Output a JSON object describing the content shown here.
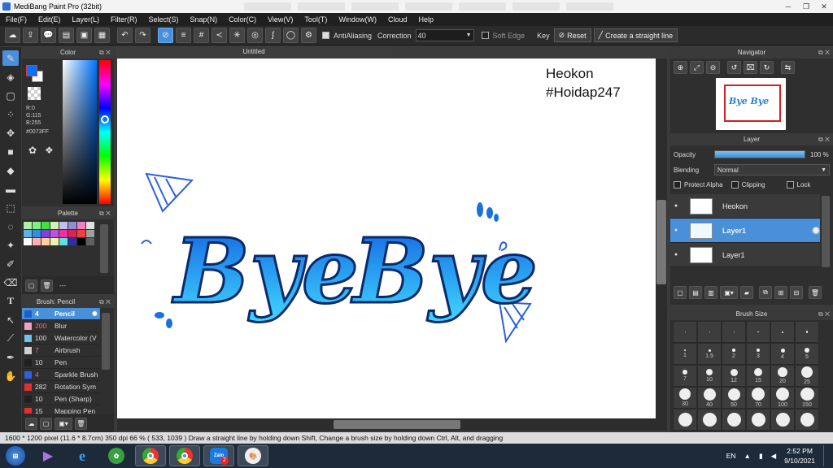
{
  "app": {
    "title": "MediBang Paint Pro (32bit)"
  },
  "menu": [
    "File(F)",
    "Edit(E)",
    "Layer(L)",
    "Filter(R)",
    "Select(S)",
    "Snap(N)",
    "Color(C)",
    "View(V)",
    "Tool(T)",
    "Window(W)",
    "Cloud",
    "Help"
  ],
  "toolbar": {
    "antialiasing_label": "AntiAliasing",
    "correction_label": "Correction",
    "correction_value": "40",
    "soft_edge_label": "Soft Edge",
    "key_label": "Key",
    "reset_label": "Reset",
    "straight_line_label": "Create a straight line"
  },
  "color_panel": {
    "title": "Color",
    "r": "R:0",
    "g": "G:115",
    "b": "B:255",
    "hex": "#0073FF",
    "primary_color": "#0073FF",
    "secondary_color": "#FFFFFF"
  },
  "palette_panel": {
    "title": "Palette",
    "colors": [
      "#b0f0a0",
      "#80f080",
      "#40e040",
      "#d0f0b0",
      "#c0c0f0",
      "#9090d0",
      "#f080c0",
      "#e0e0e0",
      "#60b0f0",
      "#3090e0",
      "#8040e0",
      "#c050e0",
      "#f030a0",
      "#e02050",
      "#f04040",
      "#a0a0a0",
      "#ffffff",
      "#ffb0b0",
      "#ffd0a0",
      "#f0f0b0",
      "#60e0e0",
      "#3030a0",
      "#000000",
      "#606060"
    ],
    "dash": "---"
  },
  "brush_panel": {
    "title": "Brush: Pencil",
    "items": [
      {
        "size": "4",
        "name": "Pencil",
        "color": "#1a5fd0",
        "selected": true
      },
      {
        "size": "200",
        "name": "Blur",
        "color": "#f0a0c0"
      },
      {
        "size": "100",
        "name": "Watercolor (V",
        "color": "#70c0f0"
      },
      {
        "size": "7",
        "name": "Airbrush",
        "color": "#d0d0d0"
      },
      {
        "size": "10",
        "name": "Pen",
        "color": "#202020"
      },
      {
        "size": "4",
        "name": "Sparkle Brush",
        "color": "#3060e0"
      },
      {
        "size": "282",
        "name": "Rotation Sym",
        "color": "#e03030"
      },
      {
        "size": "10",
        "name": "Pen (Sharp)",
        "color": "#202020"
      },
      {
        "size": "15",
        "name": "Mapping Pen",
        "color": "#e03030"
      }
    ]
  },
  "canvas": {
    "tab_title": "Untitled",
    "text_line1": "Heokon",
    "text_line2": "#Hoidap247",
    "word1": "Bye",
    "word2": "Bye"
  },
  "navigator": {
    "title": "Navigator",
    "thumb_text": "Bye Bye"
  },
  "layer_panel": {
    "title": "Layer",
    "opacity_label": "Opacity",
    "opacity_value": "100 %",
    "opacity_fraction": 1.0,
    "blending_label": "Blending",
    "blending_value": "Normal",
    "protect_alpha": "Protect Alpha",
    "clipping": "Clipping",
    "lock": "Lock",
    "layers": [
      {
        "name": "Heokon",
        "selected": false
      },
      {
        "name": "Layer1",
        "selected": true
      },
      {
        "name": "Layer1",
        "selected": false
      }
    ]
  },
  "brush_size_panel": {
    "title": "Brush Size",
    "sizes": [
      "",
      "",
      "",
      "",
      "",
      "",
      "1",
      "1.5",
      "2",
      "3",
      "4",
      "5",
      "7",
      "10",
      "12",
      "15",
      "20",
      "25",
      "30",
      "40",
      "50",
      "70",
      "100",
      "150",
      "",
      "",
      "",
      "",
      "",
      ""
    ]
  },
  "status": {
    "text": "1600 * 1200 pixel   (11.6 * 8.7cm)   350 dpi   66 %   ( 533, 1039 )   Draw a straight line by holding down Shift, Change a brush size by holding down Ctrl, Alt, and dragging"
  },
  "taskbar": {
    "lang": "EN",
    "time": "2:52 PM",
    "date": "9/10/2021",
    "zalo_label": "Zalo",
    "zalo_badge": "2"
  }
}
